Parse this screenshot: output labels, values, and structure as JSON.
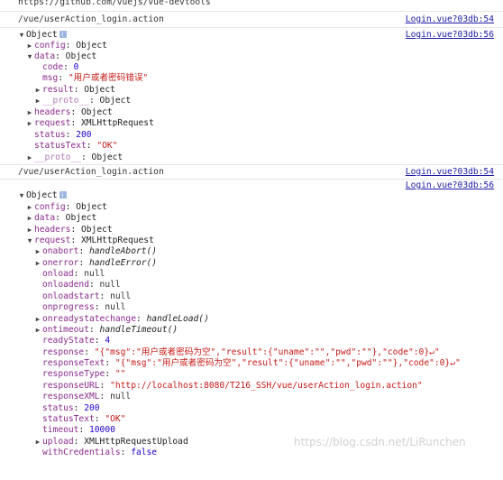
{
  "top_partial_text": "https://github.com/vuejs/vue-devtools",
  "top_partial_link": "",
  "log1": {
    "url": "/vue/userAction_login.action",
    "source": "Login.vue?03db:54"
  },
  "obj1": {
    "source": "Login.vue?03db:56",
    "root": "Object",
    "config_key": "config",
    "config_val": "Object",
    "data_key": "data",
    "data_val": "Object",
    "code_key": "code",
    "code_val": "0",
    "msg_key": "msg",
    "msg_val": "\"用户或者密码错误\"",
    "result_key": "result",
    "result_val": "Object",
    "proto_key": "__proto__",
    "proto_val": "Object",
    "headers_key": "headers",
    "headers_val": "Object",
    "request_key": "request",
    "request_val": "XMLHttpRequest",
    "status_key": "status",
    "status_val": "200",
    "statusText_key": "statusText",
    "statusText_val": "\"OK\"",
    "proto2_key": "__proto__",
    "proto2_val": "Object"
  },
  "log2": {
    "url": "/vue/userAction_login.action",
    "source": "Login.vue?03db:54"
  },
  "obj2": {
    "source": "Login.vue?03db:56",
    "root": "Object",
    "config_key": "config",
    "config_val": "Object",
    "data_key": "data",
    "data_val": "Object",
    "headers_key": "headers",
    "headers_val": "Object",
    "request_key": "request",
    "request_val": "XMLHttpRequest",
    "onabort_key": "onabort",
    "onabort_val": "handleAbort()",
    "onerror_key": "onerror",
    "onerror_val": "handleError()",
    "onload_key": "onload",
    "onload_val": "null",
    "onloadend_key": "onloadend",
    "onloadend_val": "null",
    "onloadstart_key": "onloadstart",
    "onloadstart_val": "null",
    "onprogress_key": "onprogress",
    "onprogress_val": "null",
    "onrsc_key": "onreadystatechange",
    "onrsc_val": "handleLoad()",
    "ontimeout_key": "ontimeout",
    "ontimeout_val": "handleTimeout()",
    "readyState_key": "readyState",
    "readyState_val": "4",
    "response_key": "response",
    "response_val": "\"{\"msg\":\"用户或者密码为空\",\"result\":{\"uname\":\"\",\"pwd\":\"\"},\"code\":0}↵\"",
    "responseText_key": "responseText",
    "responseText_val": "\"{\"msg\":\"用户或者密码为空\",\"result\":{\"uname\":\"\",\"pwd\":\"\"},\"code\":0}↵\"",
    "responseType_key": "responseType",
    "responseType_val": "\"\"",
    "responseURL_key": "responseURL",
    "responseURL_val": "\"http://localhost:8080/T216_SSH/vue/userAction_login.action\"",
    "responseXML_key": "responseXML",
    "responseXML_val": "null",
    "status_key": "status",
    "status_val": "200",
    "statusText_key": "statusText",
    "statusText_val": "\"OK\"",
    "timeout_key": "timeout",
    "timeout_val": "10000",
    "upload_key": "upload",
    "upload_val": "XMLHttpRequestUpload",
    "withCredentials_key": "withCredentials",
    "withCredentials_val": "false"
  },
  "watermark": "https://blog.csdn.net/LiRunchen"
}
